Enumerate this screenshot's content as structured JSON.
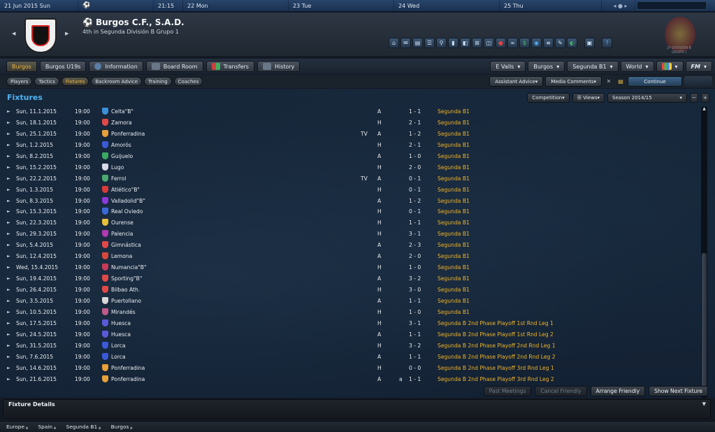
{
  "calendar": {
    "date": "21 Jun 2015",
    "day": "Sun",
    "time": "21:15",
    "days": [
      "22 Mon",
      "23 Tue",
      "24 Wed",
      "25 Thu"
    ]
  },
  "club": {
    "name": "Burgos C.F., S.A.D.",
    "position": "4th in Segunda División B Grupo 1"
  },
  "federation": {
    "text_line1": "2ª DIVISIÓN B",
    "text_line2": "GRUPO I"
  },
  "tabs": [
    {
      "label": "Burgos",
      "active": true
    },
    {
      "label": "Burgos U19s",
      "active": false
    },
    {
      "label": "Information",
      "active": false
    },
    {
      "label": "Board Room",
      "active": false
    },
    {
      "label": "Transfers",
      "active": false
    },
    {
      "label": "History",
      "active": false
    }
  ],
  "right_tabs": [
    "E Valls",
    "Burgos",
    "Segunda B1",
    "World",
    "FM"
  ],
  "subtabs": [
    {
      "label": "Players",
      "active": false
    },
    {
      "label": "Tactics",
      "active": false
    },
    {
      "label": "Fixtures",
      "active": true
    },
    {
      "label": "Backroom Advice",
      "active": false
    },
    {
      "label": "Training",
      "active": false
    },
    {
      "label": "Coaches",
      "active": false
    }
  ],
  "assistant_advice": "Assistant Advice",
  "media_comments": "Media Comments",
  "continue_label": "Continue",
  "page_title": "Fixtures",
  "controls": {
    "competition": "Competition",
    "views": "Views",
    "season": "Season 2014/15"
  },
  "fixtures": [
    {
      "date": "Sun, 11.1.2015",
      "time": "19:00",
      "opponent": "Celta\"B\"",
      "tv": "",
      "venue": "A",
      "note": "",
      "score": "1 - 1",
      "competition": "Segunda B1",
      "logo": "#3a8fd8"
    },
    {
      "date": "Sun, 18.1.2015",
      "time": "19:00",
      "opponent": "Zamora",
      "tv": "",
      "venue": "H",
      "note": "",
      "score": "2 - 1",
      "competition": "Segunda B1",
      "logo": "#e04848"
    },
    {
      "date": "Sun, 25.1.2015",
      "time": "19:00",
      "opponent": "Ponferradina",
      "tv": "TV",
      "venue": "A",
      "note": "",
      "score": "1 - 2",
      "competition": "Segunda B1",
      "logo": "#e8a03a"
    },
    {
      "date": "Sun, 1.2.2015",
      "time": "19:00",
      "opponent": "Amorós",
      "tv": "",
      "venue": "H",
      "note": "",
      "score": "2 - 1",
      "competition": "Segunda B1",
      "logo": "#3a5ad8"
    },
    {
      "date": "Sun, 8.2.2015",
      "time": "19:00",
      "opponent": "Guijuelo",
      "tv": "",
      "venue": "A",
      "note": "",
      "score": "1 - 0",
      "competition": "Segunda B1",
      "logo": "#3aa860"
    },
    {
      "date": "Sun, 15.2.2015",
      "time": "19:00",
      "opponent": "Lugo",
      "tv": "",
      "venue": "H",
      "note": "",
      "score": "2 - 0",
      "competition": "Segunda B1",
      "logo": "#d8d8e8"
    },
    {
      "date": "Sun, 22.2.2015",
      "time": "19:00",
      "opponent": "Ferrol",
      "tv": "TV",
      "venue": "A",
      "note": "",
      "score": "0 - 1",
      "competition": "Segunda B1",
      "logo": "#4aa870"
    },
    {
      "date": "Sun, 1.3.2015",
      "time": "19:00",
      "opponent": "Atlético\"B\"",
      "tv": "",
      "venue": "H",
      "note": "",
      "score": "0 - 1",
      "competition": "Segunda B1",
      "logo": "#d83a3a"
    },
    {
      "date": "Sun, 8.3.2015",
      "time": "19:00",
      "opponent": "Valladolid\"B\"",
      "tv": "",
      "venue": "A",
      "note": "",
      "score": "1 - 2",
      "competition": "Segunda B1",
      "logo": "#8a3ad8"
    },
    {
      "date": "Sun, 15.3.2015",
      "time": "19:00",
      "opponent": "Real Oviedo",
      "tv": "",
      "venue": "H",
      "note": "",
      "score": "0 - 1",
      "competition": "Segunda B1",
      "logo": "#3a6ad8"
    },
    {
      "date": "Sun, 22.3.2015",
      "time": "19:00",
      "opponent": "Ourense",
      "tv": "",
      "venue": "H",
      "note": "",
      "score": "1 - 1",
      "competition": "Segunda B1",
      "logo": "#e8c03a"
    },
    {
      "date": "Sun, 29.3.2015",
      "time": "19:00",
      "opponent": "Palencia",
      "tv": "",
      "venue": "H",
      "note": "",
      "score": "3 - 1",
      "competition": "Segunda B1",
      "logo": "#b03ab0"
    },
    {
      "date": "Sun, 5.4.2015",
      "time": "19:00",
      "opponent": "Gimnástica",
      "tv": "",
      "venue": "A",
      "note": "",
      "score": "2 - 3",
      "competition": "Segunda B1",
      "logo": "#e04848"
    },
    {
      "date": "Sun, 12.4.2015",
      "time": "19:00",
      "opponent": "Lemona",
      "tv": "",
      "venue": "A",
      "note": "",
      "score": "2 - 0",
      "competition": "Segunda B1",
      "logo": "#d8483a"
    },
    {
      "date": "Wed, 15.4.2015",
      "time": "19:00",
      "opponent": "Numancia\"B\"",
      "tv": "",
      "venue": "H",
      "note": "",
      "score": "1 - 0",
      "competition": "Segunda B1",
      "logo": "#c83a5a"
    },
    {
      "date": "Sun, 19.4.2015",
      "time": "19:00",
      "opponent": "Sporting\"B\"",
      "tv": "",
      "venue": "A",
      "note": "",
      "score": "3 - 2",
      "competition": "Segunda B1",
      "logo": "#e04848"
    },
    {
      "date": "Sun, 26.4.2015",
      "time": "19:00",
      "opponent": "Bilbao Ath.",
      "tv": "",
      "venue": "H",
      "note": "",
      "score": "3 - 0",
      "competition": "Segunda B1",
      "logo": "#e04848"
    },
    {
      "date": "Sun, 3.5.2015",
      "time": "19:00",
      "opponent": "Puertollano",
      "tv": "",
      "venue": "A",
      "note": "",
      "score": "1 - 1",
      "competition": "Segunda B1",
      "logo": "#d8d8d8"
    },
    {
      "date": "Sun, 10.5.2015",
      "time": "19:00",
      "opponent": "Mirandés",
      "tv": "",
      "venue": "H",
      "note": "",
      "score": "1 - 0",
      "competition": "Segunda B1",
      "logo": "#c05a8a"
    },
    {
      "date": "Sun, 17.5.2015",
      "time": "19:00",
      "opponent": "Huesca",
      "tv": "",
      "venue": "H",
      "note": "",
      "score": "3 - 1",
      "competition": "Segunda B 2nd Phase Playoff 1st Rnd Leg 1",
      "logo": "#5a5ad8"
    },
    {
      "date": "Sun, 24.5.2015",
      "time": "19:00",
      "opponent": "Huesca",
      "tv": "",
      "venue": "A",
      "note": "",
      "score": "1 - 1",
      "competition": "Segunda B 2nd Phase Playoff 1st Rnd Leg 2",
      "logo": "#5a5ad8"
    },
    {
      "date": "Sun, 31.5.2015",
      "time": "19:00",
      "opponent": "Lorca",
      "tv": "",
      "venue": "H",
      "note": "",
      "score": "3 - 2",
      "competition": "Segunda B 2nd Phase Playoff 2nd Rnd Leg 1",
      "logo": "#3a5ad8"
    },
    {
      "date": "Sun, 7.6.2015",
      "time": "19:00",
      "opponent": "Lorca",
      "tv": "",
      "venue": "A",
      "note": "",
      "score": "1 - 1",
      "competition": "Segunda B 2nd Phase Playoff 2nd Rnd Leg 2",
      "logo": "#3a5ad8"
    },
    {
      "date": "Sun, 14.6.2015",
      "time": "19:00",
      "opponent": "Ponferradina",
      "tv": "",
      "venue": "H",
      "note": "",
      "score": "0 - 0",
      "competition": "Segunda B 2nd Phase Playoff 3rd Rnd Leg 1",
      "logo": "#e8a03a"
    },
    {
      "date": "Sun, 21.6.2015",
      "time": "19:00",
      "opponent": "Ponferradina",
      "tv": "",
      "venue": "A",
      "note": "a",
      "score": "1 - 1",
      "competition": "Segunda B 2nd Phase Playoff 3rd Rnd Leg 2",
      "logo": "#e8a03a"
    }
  ],
  "actions": {
    "past_meetings": "Past Meetings",
    "cancel_friendly": "Cancel Friendly",
    "arrange_friendly": "Arrange Friendly",
    "show_next_fixture": "Show Next Fixture"
  },
  "details_title": "Fixture Details",
  "breadcrumb": [
    "Europe",
    "Spain",
    "Segunda B1",
    "Burgos"
  ]
}
